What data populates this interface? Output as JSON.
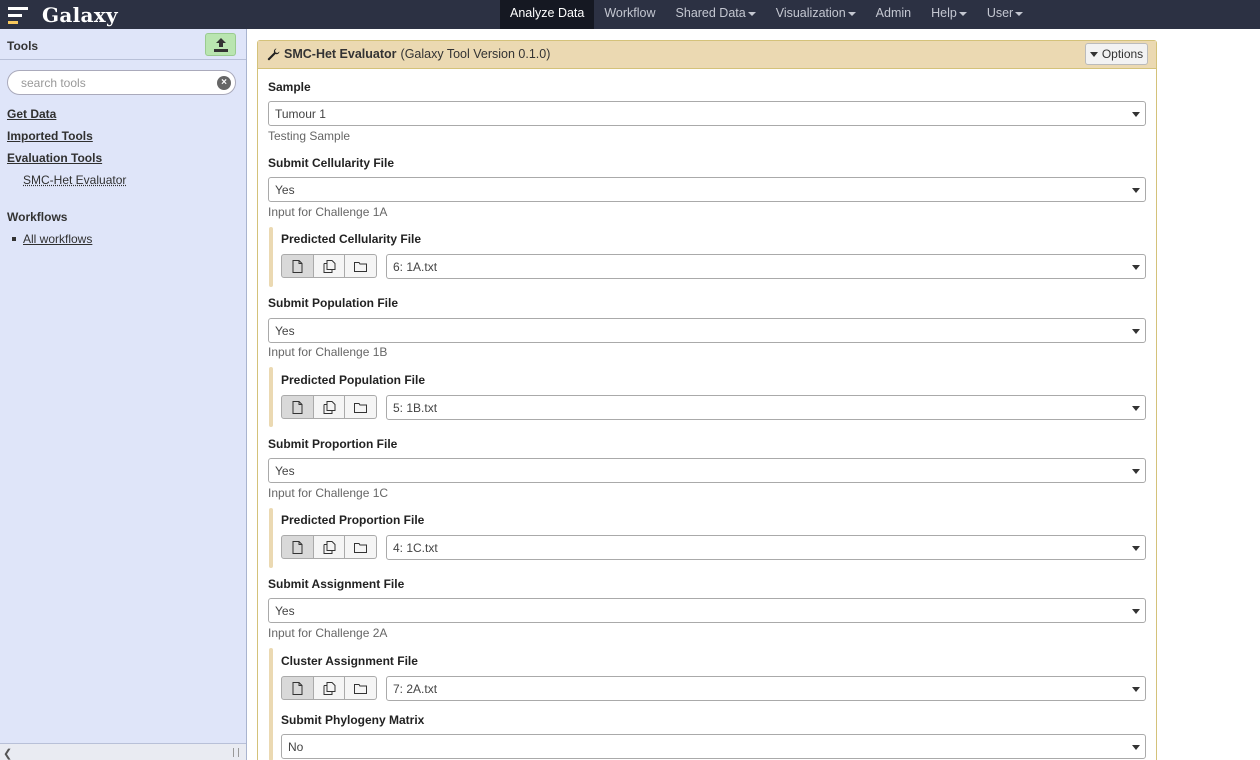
{
  "masthead": {
    "brand": "Galaxy",
    "nav": [
      {
        "label": "Analyze Data",
        "active": true,
        "dropdown": false
      },
      {
        "label": "Workflow",
        "active": false,
        "dropdown": false
      },
      {
        "label": "Shared Data",
        "active": false,
        "dropdown": true
      },
      {
        "label": "Visualization",
        "active": false,
        "dropdown": true
      },
      {
        "label": "Admin",
        "active": false,
        "dropdown": false
      },
      {
        "label": "Help",
        "active": false,
        "dropdown": true
      },
      {
        "label": "User",
        "active": false,
        "dropdown": true
      }
    ]
  },
  "tools_panel": {
    "title": "Tools",
    "search_placeholder": "search tools",
    "sections": [
      {
        "label": "Get Data"
      },
      {
        "label": "Imported Tools"
      },
      {
        "label": "Evaluation Tools",
        "items": [
          "SMC-Het Evaluator"
        ]
      }
    ],
    "workflows": {
      "title": "Workflows",
      "items": [
        "All workflows"
      ]
    }
  },
  "tool_form": {
    "name": "SMC-Het Evaluator",
    "version": "(Galaxy Tool Version 0.1.0)",
    "options_label": "Options",
    "sample": {
      "label": "Sample",
      "value": "Tumour 1",
      "help": "Testing Sample"
    },
    "cellularity": {
      "label": "Submit Cellularity File",
      "value": "Yes",
      "help": "Input for Challenge 1A",
      "file": {
        "label": "Predicted Cellularity File",
        "value": "6: 1A.txt"
      }
    },
    "population": {
      "label": "Submit Population File",
      "value": "Yes",
      "help": "Input for Challenge 1B",
      "file": {
        "label": "Predicted Population File",
        "value": "5: 1B.txt"
      }
    },
    "proportion": {
      "label": "Submit Proportion File",
      "value": "Yes",
      "help": "Input for Challenge 1C",
      "file": {
        "label": "Predicted Proportion File",
        "value": "4: 1C.txt"
      }
    },
    "assignment": {
      "label": "Submit Assignment File",
      "value": "Yes",
      "help": "Input for Challenge 2A",
      "file": {
        "label": "Cluster Assignment File",
        "value": "7: 2A.txt"
      },
      "phylogeny": {
        "label": "Submit Phylogeny Matrix",
        "value": "No"
      }
    }
  }
}
